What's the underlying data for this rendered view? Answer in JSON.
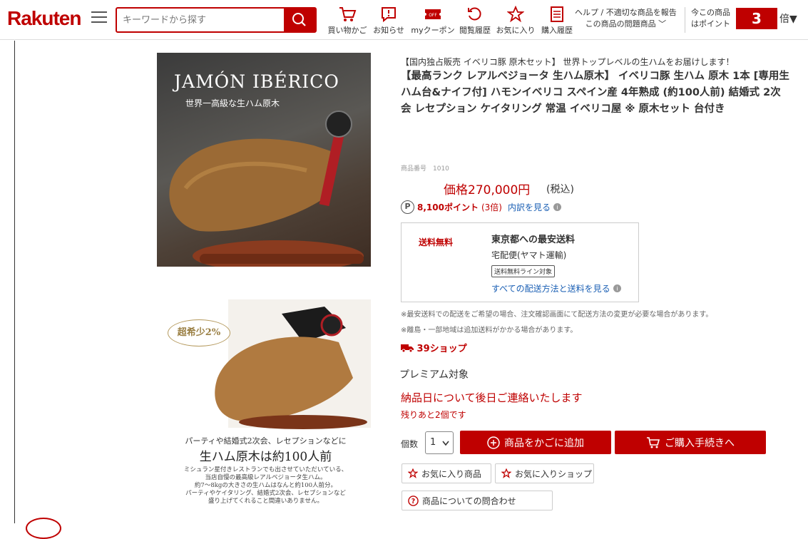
{
  "header": {
    "logo": "Rakuten",
    "search_placeholder": "キーワードから探す",
    "nav": [
      {
        "label": "買い物かご",
        "icon": "cart-icon"
      },
      {
        "label": "お知らせ",
        "icon": "notice-icon"
      },
      {
        "label": "myクーポン",
        "icon": "coupon-icon"
      },
      {
        "label": "閲覧履歴",
        "icon": "history-icon"
      },
      {
        "label": "お気に入り",
        "icon": "star-icon"
      },
      {
        "label": "購入履歴",
        "icon": "receipt-icon"
      }
    ],
    "help_line1": "ヘルプ / 不適切な商品を報告",
    "help_line2": "この商品の問題商品 ﹀",
    "points_line1": "今この商品",
    "points_line2": "はポイント",
    "points_multiplier": "3",
    "points_unit": "倍▼"
  },
  "images": {
    "main_title": "JAMÓN IBÉRICO",
    "main_subtitle": "世界一高級な生ハム原木",
    "badge_label": "超希少2%",
    "caption_small": "パーティや結婚式2次会、レセプションなどに",
    "caption_big": "生ハム原木は約100人前",
    "caption_body": [
      "ミシュラン星付きレストランでも出させていただいている、",
      "当店自慢の最高級レアルベジョータ生ハム。",
      "約7～8kgの大きさの生ハムはなんと約100人前分。",
      "パーティやケイタリング、結婚式2次会、レセプションなど",
      "盛り上げてくれること間違いありません。"
    ]
  },
  "product": {
    "catch": "【国内独占販売 イベリコ豚 原木セット】 世界トップレベルの生ハムをお届けします！",
    "title": "【最高ランク レアルベジョータ 生ハム原木】 イベリコ豚 生ハム 原木 1本 [専用生ハム台&ナイフ付] ハモンイベリコ スペイン産 4年熟成 (約100人前) 結婚式 2次会 レセプション ケイタリング 常温 イベリコ屋 ※ 原木セット 台付き",
    "item_number": "商品番号　1010",
    "price": "価格270,000円",
    "tax": "(税込)",
    "points": "8,100ポイント",
    "points_times": "(3倍)",
    "points_detail": "内訳を見る"
  },
  "shipping": {
    "free_label": "送料無料",
    "title": "東京都への最安送料",
    "carrier": "宅配便(ヤマト運輸)",
    "badge": "送料無料ライン対象",
    "link": "すべての配送方法と送料を見る",
    "note1": "※最安送料での配送をご希望の場合、注文確認画面にて配送方法の変更が必要な場合があります。",
    "note2": "※離島・一部地域は追加送料がかかる場合があります。"
  },
  "shop39": "39ショップ",
  "premium": "プレミアム対象",
  "delivery_note": "納品日について後日ご連絡いたします",
  "remaining": "残りあと2個です",
  "purchase": {
    "qty_label": "個数",
    "qty_value": "1",
    "add_cart": "商品をかごに追加",
    "checkout": "ご購入手続きへ",
    "fav_item": "お気に入り商品",
    "fav_shop": "お気に入りショップ",
    "inquiry": "商品についての問合わせ"
  }
}
